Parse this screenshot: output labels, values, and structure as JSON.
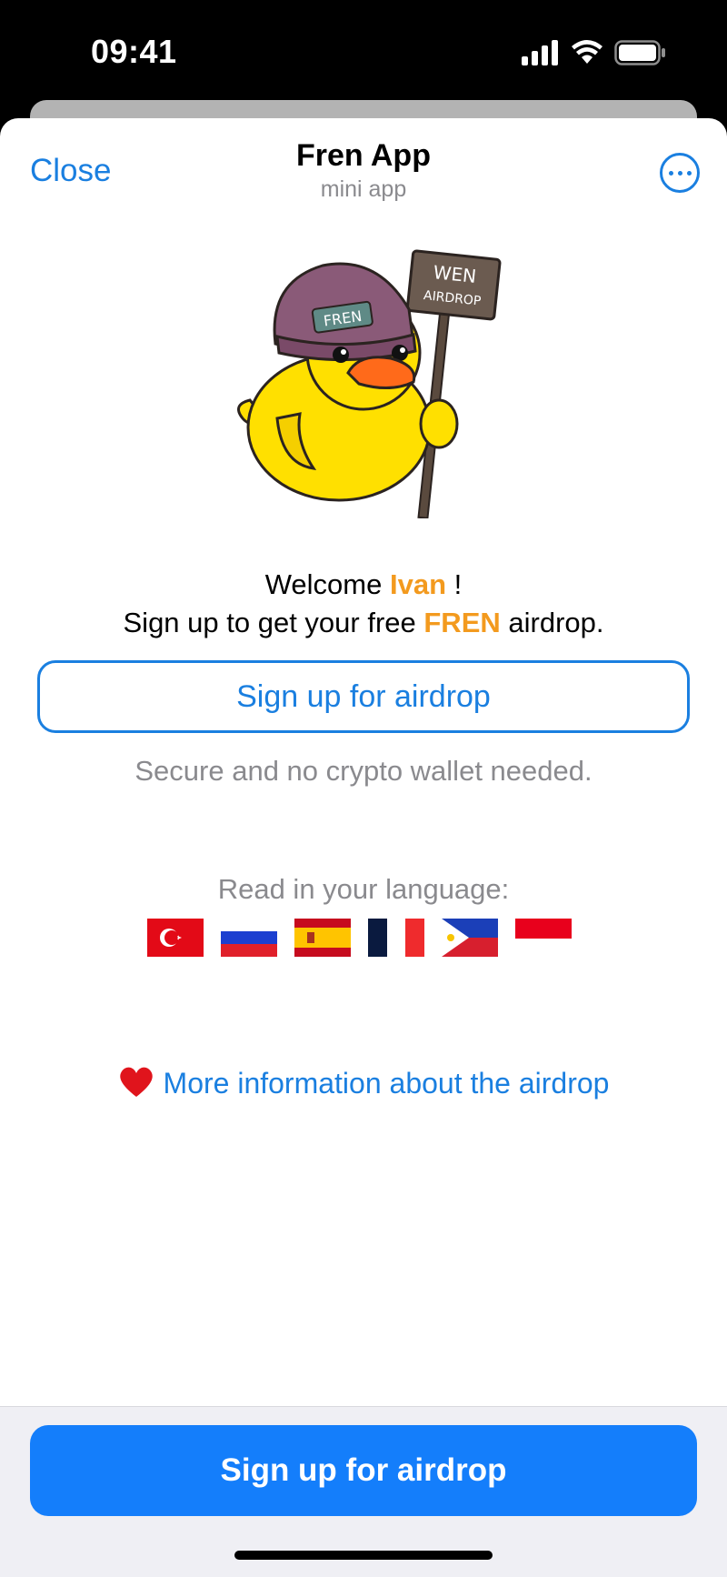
{
  "status_bar": {
    "time": "09:41"
  },
  "header": {
    "close_label": "Close",
    "title": "Fren App",
    "subtitle": "mini app"
  },
  "mascot": {
    "hat_label": "FREN",
    "sign_line1": "WEN",
    "sign_line2": "AIRDROP"
  },
  "welcome": {
    "prefix": "Welcome ",
    "name": "Ivan",
    "suffix": " !",
    "line2_prefix": "Sign up to get your free ",
    "token": "FREN",
    "line2_suffix": " airdrop."
  },
  "signup_outline_label": "Sign up for airdrop",
  "secure_text": "Secure and no crypto wallet needed.",
  "language": {
    "label": "Read in your language:",
    "flags": [
      "turkey",
      "russia",
      "spain",
      "france",
      "philippines",
      "indonesia"
    ]
  },
  "more_info_label": "More information about the airdrop",
  "bottom": {
    "primary_label": "Sign up for airdrop"
  },
  "colors": {
    "accent": "#f39a1e",
    "link": "#1a7fe0",
    "primary_button": "#147efb"
  }
}
